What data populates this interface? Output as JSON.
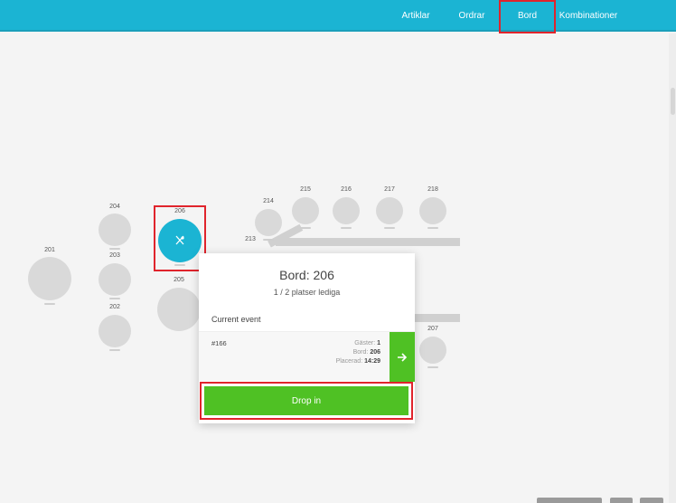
{
  "nav": {
    "items": [
      {
        "label": "Artiklar"
      },
      {
        "label": "Ordrar"
      },
      {
        "label": "Bord"
      },
      {
        "label": "Kombinationer"
      }
    ]
  },
  "tables": [
    {
      "number": "201"
    },
    {
      "number": "202"
    },
    {
      "number": "203"
    },
    {
      "number": "204"
    },
    {
      "number": "205"
    },
    {
      "number": "206"
    },
    {
      "number": "207"
    },
    {
      "number": "213"
    },
    {
      "number": "214"
    },
    {
      "number": "215"
    },
    {
      "number": "216"
    },
    {
      "number": "217"
    },
    {
      "number": "218"
    }
  ],
  "popup": {
    "title": "Bord: 206",
    "availability": "1 / 2 platser lediga",
    "section_label": "Current event",
    "event": {
      "id": "#166",
      "guests_label": "Gäster:",
      "guests_value": "1",
      "table_label": "Bord:",
      "table_value": "206",
      "placed_label": "Placerad:",
      "placed_value": "14:29"
    },
    "drop_in_label": "Drop in"
  },
  "colors": {
    "accent": "#1bb4d3",
    "success": "#4fc124",
    "highlight": "#e0242c"
  }
}
